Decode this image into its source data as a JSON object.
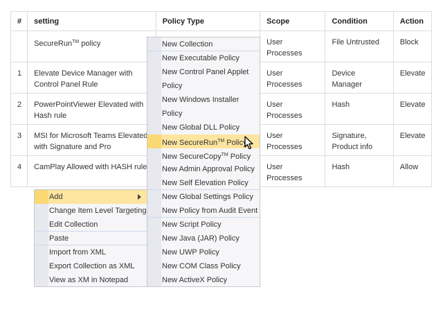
{
  "table": {
    "headers": [
      "#",
      "setting",
      "Policy Type",
      "Scope",
      "Condition",
      "Action"
    ],
    "rows": [
      {
        "num": "",
        "setting": "SecureRun",
        "setting_tm": "TM",
        "setting_rest": " policy",
        "policy_type": "",
        "scope": "User Processes",
        "condition": "File Untrusted",
        "action": "Block"
      },
      {
        "num": "1",
        "setting": "Elevate Device Manager with Control Panel Rule",
        "policy_type": "",
        "scope": "User Processes",
        "condition": "Device Manager",
        "action": "Elevate"
      },
      {
        "num": "2",
        "setting": "PowerPointViewer Elevated with Hash rule",
        "policy_type": "",
        "scope": "User Processes",
        "condition": "Hash",
        "action": "Elevate"
      },
      {
        "num": "3",
        "setting": "MSI for Microsoft Teams Elevated with Signature and Pro",
        "policy_type": "",
        "scope": "User Processes",
        "condition": "Signature, Product info",
        "action": "Elevate"
      },
      {
        "num": "4",
        "setting": "CamPlay Allowed with HASH rule",
        "policy_type": "",
        "scope": "User Processes",
        "condition": "Hash",
        "action": "Allow"
      }
    ]
  },
  "context_menu": {
    "items": [
      {
        "label": "Add",
        "highlighted": true,
        "has_submenu": true
      },
      {
        "label": "Change Item Level Targeting"
      },
      {
        "label": "Edit Collection"
      },
      {
        "label": "Paste"
      },
      {
        "label": "Import from XML"
      },
      {
        "label": "Export Collection as XML"
      },
      {
        "label": "View as XM in Notepad"
      }
    ]
  },
  "submenu": {
    "items": [
      {
        "label": "New Collection"
      },
      {
        "label": "New Executable Policy"
      },
      {
        "label": "New Control Panel Applet"
      },
      {
        "label": "Policy"
      },
      {
        "label": "New Windows Installer"
      },
      {
        "label": "Policy"
      },
      {
        "label": "New Global DLL Policy"
      },
      {
        "label": "New SecureRun",
        "tm": "TM",
        "rest": " Policy",
        "highlighted": true
      },
      {
        "label": "New SecureCopy",
        "tm": "TM",
        "rest": " Policy"
      },
      {
        "label": "New Admin Approval Policy"
      },
      {
        "label": "New Self Elevation Policy"
      },
      {
        "label": "New Global Settings Policy"
      },
      {
        "label": "New Policy from Audit Event"
      },
      {
        "label": "New Script Policy"
      },
      {
        "label": "New Java (JAR) Policy"
      },
      {
        "label": "New UWP Policy"
      },
      {
        "label": "New COM Class Policy"
      },
      {
        "label": "New ActiveX Policy"
      }
    ]
  },
  "colors": {
    "highlight": "#fde59f",
    "menu_bg": "#f6f6f8",
    "gutter": "#e8e9ef",
    "border": "#dcdcdc"
  }
}
